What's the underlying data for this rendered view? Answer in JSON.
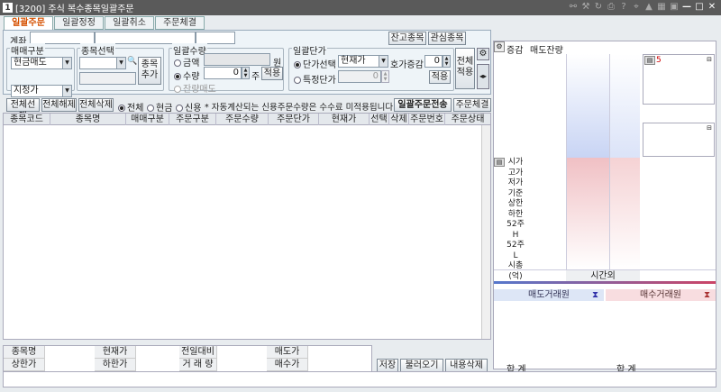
{
  "window": {
    "number": "1",
    "title": "[3200] 주식 복수종목일괄주문"
  },
  "tabs": [
    "일괄주문",
    "일괄정정",
    "일괄취소",
    "주문체결"
  ],
  "top": {
    "account_label": "계좌",
    "balance_btn": "잔고종목",
    "interest_btn": "관심종목"
  },
  "group_trade": {
    "title": "매매구분",
    "trade_type": "현금매도",
    "price_type": "지정가"
  },
  "group_stock": {
    "title": "종목선택",
    "add_btn": "종목\n추가"
  },
  "group_qty": {
    "title": "일괄수량",
    "amount": "금액",
    "qty": "수량",
    "won": "원",
    "qty_value": "0",
    "unit": "주",
    "apply": "적용",
    "remain_sell": "잔량매도"
  },
  "group_price": {
    "title": "일괄단가",
    "price_select": "단가선택",
    "price_select_value": "현재가",
    "tick_label": "호가증감",
    "tick_value": "0",
    "tick_apply": "적용",
    "specific": "특정단가",
    "specific_value": "0",
    "apply_all": "전체\n적용"
  },
  "actions": {
    "select_all": "전체선택",
    "deselect_all": "전체해제",
    "delete_all": "전체삭제",
    "filter_all": "전체",
    "filter_cash": "현금",
    "filter_credit": "신용",
    "notice": "* 자동계산되는 신용주문수량은 수수료 미적용됩니다.",
    "send_btn": "일괄주문전송",
    "fill_btn": "주문체결"
  },
  "grid": {
    "columns": [
      "종목코드",
      "종목명",
      "매매구분",
      "주문구분",
      "주문수량",
      "주문단가",
      "현재가",
      "선택",
      "삭제",
      "주문번호",
      "주문상태"
    ]
  },
  "info": {
    "stock_name": "종목명",
    "current": "현재가",
    "prev_diff": "전일대비",
    "ask": "매도가",
    "upper": "상한가",
    "lower": "하한가",
    "volume": "거 래 량",
    "bid": "매수가",
    "save": "저장",
    "load": "불러오기",
    "delete_contents": "내용삭제"
  },
  "orderbook": {
    "col_diff": "증감",
    "col_ask_remain": "매도잔량",
    "labels": [
      "시가",
      "고가",
      "저가",
      "기준",
      "상한",
      "하한",
      "52주H",
      "52주L",
      "시총",
      "(억)"
    ],
    "marker": "5",
    "after_hours": "시간외",
    "ask_broker": "매도거래원",
    "bid_broker": "매수거래원",
    "total1": "합  계",
    "total2": "합  계"
  }
}
